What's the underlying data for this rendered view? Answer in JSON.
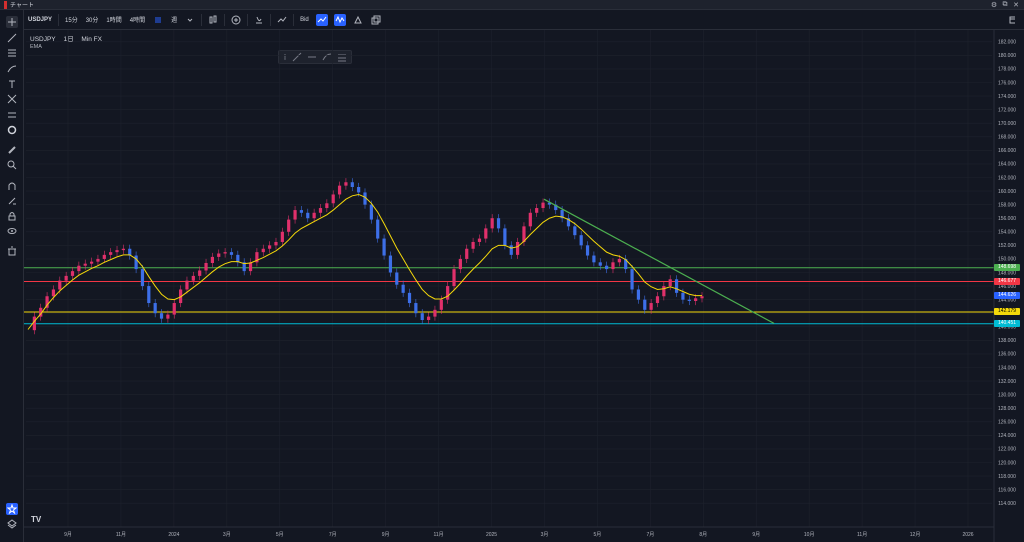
{
  "window": {
    "title": "チャート"
  },
  "toolbar": {
    "symbol": "USDJPY",
    "intervals": [
      "15分",
      "30分",
      "1時間",
      "4時間"
    ],
    "timeframe": "週",
    "bid_label": "Bid"
  },
  "legend": {
    "symbol": "USDJPY",
    "interval": "1日",
    "source": "Min FX",
    "indicator": "EMA"
  },
  "price_tags": [
    {
      "label": "148.698",
      "value": 148.698,
      "color": "#4caf50"
    },
    {
      "label": "146.677",
      "value": 146.677,
      "color": "#f23645"
    },
    {
      "label": "144.626",
      "value": 144.626,
      "color": "#2962ff"
    },
    {
      "label": "142.179",
      "value": 142.179,
      "color": "#f5d90a"
    },
    {
      "label": "140.451",
      "value": 140.451,
      "color": "#00bcd4"
    }
  ],
  "horizontal_lines": [
    {
      "value": 148.698,
      "color": "#4caf50"
    },
    {
      "value": 146.677,
      "color": "#f23645"
    },
    {
      "value": 142.179,
      "color": "#f5d90a"
    },
    {
      "value": 140.451,
      "color": "#00bcd4"
    }
  ],
  "axis": {
    "y_ticks": [
      "182.000",
      "180.000",
      "178.000",
      "176.000",
      "174.000",
      "172.000",
      "170.000",
      "168.000",
      "166.000",
      "164.000",
      "162.000",
      "160.000",
      "158.000",
      "156.000",
      "154.000",
      "152.000",
      "150.000",
      "148.000",
      "146.000",
      "144.000",
      "142.000",
      "140.000",
      "138.000",
      "136.000",
      "134.000",
      "132.000",
      "130.000",
      "128.000",
      "126.000",
      "124.000",
      "122.000",
      "120.000",
      "118.000",
      "116.000",
      "114.000"
    ],
    "y_range": [
      113,
      183
    ],
    "x_labels": [
      "9月",
      "11月",
      "2024",
      "3月",
      "5月",
      "7月",
      "9月",
      "11月",
      "2025",
      "3月",
      "5月",
      "7月",
      "8月",
      "9月",
      "10月",
      "11月",
      "12月",
      "2026"
    ]
  },
  "chart_data": {
    "type": "line",
    "series": [
      {
        "values": [
          139.5,
          141.5,
          142.8,
          144.5,
          145.5,
          146.8,
          147.5,
          148.2,
          149.0,
          149.3,
          149.6,
          150.0,
          150.6,
          151.0,
          151.3,
          151.5,
          150.5,
          148.5,
          146.0,
          143.5,
          142.0,
          141.2,
          141.8,
          143.5,
          145.5,
          146.8,
          147.5,
          148.3,
          149.4,
          150.3,
          150.8,
          151.0,
          150.6,
          149.5,
          148.2,
          149.5,
          151.0,
          151.5,
          152.0,
          152.5,
          154.0,
          155.8,
          157.2,
          156.8,
          156.0,
          156.8,
          157.5,
          158.2,
          159.5,
          160.8,
          161.3,
          160.6,
          159.8,
          158.0,
          155.8,
          153.0,
          150.5,
          148.0,
          146.2,
          145.0,
          143.5,
          142.0,
          141.0,
          141.5,
          142.5,
          144.0,
          146.0,
          148.5,
          150.0,
          151.5,
          152.5,
          153.0,
          154.5,
          156.0,
          154.5,
          152.0,
          150.6,
          152.5,
          154.8,
          156.8,
          157.5,
          158.3,
          158.0,
          157.2,
          156.0,
          154.8,
          153.5,
          152.0,
          150.5,
          149.5,
          149.0,
          148.5,
          149.5,
          150.0,
          148.5,
          145.5,
          144.0,
          142.5,
          143.5,
          144.5,
          146.0,
          147.0,
          145.0,
          144.0,
          143.8,
          144.2,
          144.5
        ]
      },
      {
        "values": [
          139.6,
          140.8,
          141.9,
          143.2,
          144.3,
          145.3,
          146.1,
          146.9,
          147.6,
          148.1,
          148.6,
          149.0,
          149.5,
          149.9,
          150.3,
          150.6,
          150.6,
          150.0,
          148.9,
          147.4,
          146.0,
          144.8,
          144.1,
          144.0,
          144.4,
          145.1,
          145.8,
          146.5,
          147.3,
          148.1,
          148.8,
          149.3,
          149.6,
          149.6,
          149.3,
          149.4,
          149.8,
          150.2,
          150.7,
          151.2,
          151.9,
          152.8,
          153.8,
          154.5,
          155.0,
          155.5,
          156.0,
          156.5,
          157.2,
          158.0,
          158.8,
          159.3,
          159.5,
          159.1,
          158.2,
          156.9,
          155.2,
          153.4,
          151.6,
          150.0,
          148.4,
          146.9,
          145.5,
          144.6,
          144.1,
          144.1,
          144.5,
          145.4,
          146.4,
          147.5,
          148.5,
          149.4,
          150.4,
          151.5,
          152.0,
          152.0,
          151.6,
          151.8,
          152.6,
          153.6,
          154.5,
          155.4,
          156.0,
          156.3,
          156.2,
          155.8,
          155.2,
          154.4,
          153.5,
          152.6,
          151.8,
          151.0,
          150.6,
          150.4,
          149.9,
          148.9,
          147.8,
          146.6,
          145.9,
          145.5,
          145.6,
          145.9,
          145.6,
          145.2,
          144.8,
          144.6,
          144.6
        ]
      }
    ],
    "ylim": [
      113,
      183
    ]
  }
}
